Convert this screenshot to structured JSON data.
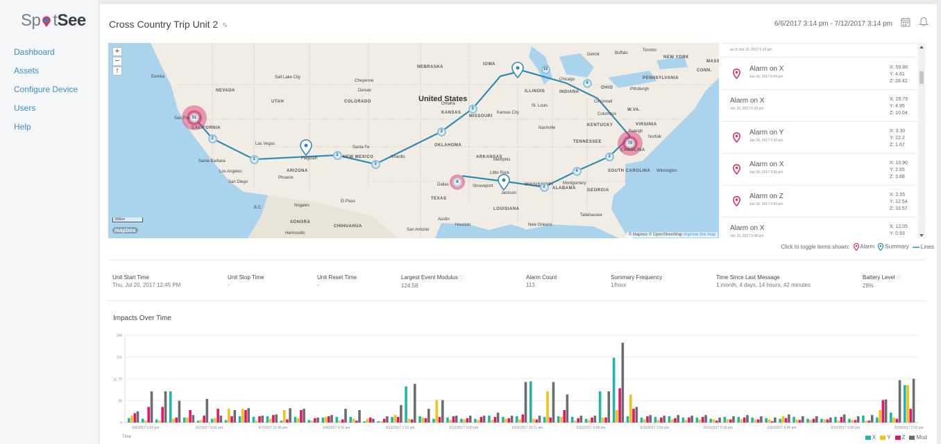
{
  "app": {
    "logo_left": "Sp",
    "logo_mid": "t",
    "logo_right": "See"
  },
  "sidebar": {
    "items": [
      {
        "label": "Dashboard"
      },
      {
        "label": "Assets"
      },
      {
        "label": "Configure Device"
      },
      {
        "label": "Users"
      },
      {
        "label": "Help"
      }
    ]
  },
  "header": {
    "title": "Cross Country Trip Unit 2",
    "date_range": "6/6/2017 3:14 pm  -  7/12/2017 3:14 pm",
    "edit_icon": "pencil-icon",
    "calendar_icon": "calendar-icon",
    "bell_icon": "bell-icon"
  },
  "map": {
    "zoom_in": "+",
    "zoom_out": "−",
    "compass": "↑",
    "scale": "300km",
    "provider": "mapbox",
    "attribution_prefix": "© Mapbox © OpenStreetMap ",
    "attribution_link": "Improve this map",
    "country_label": "United States",
    "state_labels": [
      "NEVADA",
      "UTAH",
      "COLORADO",
      "KANSAS",
      "MISSOURI",
      "NEBRASKA",
      "IOWA",
      "ILLINOIS",
      "INDIANA",
      "OHIO",
      "PENNSYLVANIA",
      "KENTUCKY",
      "TENNESSEE",
      "VIRGINIA",
      "W.VA.",
      "OKLAHOMA",
      "ARKANSAS",
      "TEXAS",
      "LOUISIANA",
      "MISSISSIPPI",
      "ALABAMA",
      "GEORGIA",
      "ARIZONA",
      "NEW MEXICO",
      "SONORA",
      "CHIHUAHUA",
      "CALIFORNIA",
      "SOUTH CAROLINA",
      "CAROLINA",
      "NEW YORK",
      "MASS.",
      "CONN."
    ],
    "city_labels": [
      "Eureka",
      "Salt Lake City",
      "Cheyenne",
      "Omaha",
      "Denver",
      "Detroit",
      "Buffalo",
      "Toronto",
      "Chicago",
      "Pittsburgh",
      "Cincinnati",
      "St. Louis",
      "Kansas City",
      "Las Vegas",
      "Flagstaff",
      "Santa Fe",
      "Amarillo",
      "Memphis",
      "Nashville",
      "Norfolk",
      "Wilmington",
      "Santa Barbara",
      "Los Angeles",
      "San Diego",
      "Phoenix",
      "El Paso",
      "Nogales",
      "Dallas",
      "Shreveport",
      "Jackson",
      "Austin",
      "Houston",
      "San Antonio",
      "New Orleans",
      "Tallahassee",
      "Hermosillo",
      "B.C.",
      "Columbus",
      "Raleigh",
      "San Francisco",
      "Montgomery",
      "Little Rock"
    ],
    "clusters": [
      {
        "count": "51",
        "kind": "alarm"
      },
      {
        "count": "2",
        "kind": "summary"
      },
      {
        "count": "3",
        "kind": "summary"
      },
      {
        "count": "2",
        "kind": "summary"
      },
      {
        "count": "3",
        "kind": "summary"
      },
      {
        "count": "3",
        "kind": "summary"
      },
      {
        "count": "3",
        "kind": "summary"
      },
      {
        "count": "15",
        "kind": "summary"
      },
      {
        "count": "4",
        "kind": "summary"
      },
      {
        "count": "70",
        "kind": "alarm"
      },
      {
        "count": "3",
        "kind": "summary"
      },
      {
        "count": "4",
        "kind": "summary"
      },
      {
        "count": "2",
        "kind": "summary"
      },
      {
        "count": "6",
        "kind": "alarm"
      }
    ]
  },
  "events": {
    "top_partial": "as of Jun 16, 2017 6:20 pm",
    "items": [
      {
        "title": "Alarm on X",
        "date": "Jun 16, 2017 6:04 pm",
        "x": "X:  59.88",
        "y": "Y:  4.61",
        "z": "Z:  28.42",
        "pin": true
      },
      {
        "title": "Alarm on X",
        "date": "Jun 16, 2017 6:03 pm",
        "x": "X:  29.79",
        "y": "Y:  4.95",
        "z": "Z:  10.04",
        "pin": false
      },
      {
        "title": "Alarm on Y",
        "date": "Jun 16, 2017 5:52 pm",
        "x": "X:  3.30",
        "y": "Y:  22.2",
        "z": "Z:  1.67",
        "pin": true
      },
      {
        "title": "Alarm on X",
        "date": "Jun 16, 2017 5:50 pm",
        "x": "X:  10.90",
        "y": "Y:  2.65",
        "z": "Z:  3.68",
        "pin": true
      },
      {
        "title": "Alarm on Z",
        "date": "Jun 16, 2017 5:50 pm",
        "x": "X:  2.55",
        "y": "Y:  12.54",
        "z": "Z:  33.57",
        "pin": true
      },
      {
        "title": "Alarm on X",
        "date": "Jun 16, 2017 5:48 pm",
        "x": "X:  12.05",
        "y": "Y:  0.93",
        "z": "Z:  3.77",
        "pin": false
      }
    ]
  },
  "toggle_legend": {
    "prefix": "Click to toggle items shown:",
    "alarm": "Alarm",
    "summary": "Summary",
    "lines": "Lines"
  },
  "stats": [
    {
      "label": "Unit Start Time",
      "value": "Thu, Jul 20, 2017 12:45 PM",
      "info": false
    },
    {
      "label": "Unit Stop Time",
      "value": "-",
      "info": false
    },
    {
      "label": "Unit Reset Time",
      "value": "-",
      "info": false
    },
    {
      "label": "Largest Event Modulus",
      "value": "124.58",
      "info": true
    },
    {
      "label": "Alarm Count",
      "value": "113",
      "info": false
    },
    {
      "label": "Summary Frequency",
      "value": "1/hour",
      "info": false
    },
    {
      "label": "Time Since Last Message",
      "value": "1 month, 4 days, 14 hours, 42 minutes",
      "info": false
    },
    {
      "label": "Battery Level",
      "value": "28%",
      "info": true
    }
  ],
  "colors": {
    "accent": "#3e8fc6",
    "alarm": "#d6336c",
    "summary": "#2e8bb5",
    "x": "#1fb5ad",
    "y": "#f5c211",
    "z": "#e5146f",
    "mod": "#6d6d6d"
  },
  "chart_data": {
    "type": "bar",
    "title": "Impacts Over Time",
    "xlabel": "Time",
    "ylabel": "G",
    "ylim": [
      0,
      140
    ],
    "yticks": [
      0,
      35,
      70,
      105,
      140
    ],
    "grid": true,
    "legend": "bottom-right",
    "x_tick_labels": [
      "6/6/2017 5:53 pm",
      "6/7/2017 5:01 pm",
      "6/7/2017 11:46 pm",
      "6/8/2017 4:16 am",
      "6/13/2017 1:22 pm",
      "6/13/2017 2:00 pm",
      "6/14/2017 10:11 am",
      "6/15/2017 5:58 pm",
      "6/16/2017 2:54 pm",
      "6/16/2017 5:39 pm",
      "6/16/2017 5:45 pm",
      "6/16/2017 5:50 pm",
      "6/20/2017 2:02 pm"
    ],
    "series": [
      {
        "name": "X",
        "values": [
          7,
          6,
          5,
          50,
          8,
          3,
          6,
          4,
          10,
          9,
          10,
          3,
          9,
          4,
          8,
          9,
          9,
          2,
          2,
          9,
          58,
          10,
          6,
          8,
          6,
          6,
          11,
          9,
          10,
          66,
          9,
          10,
          9,
          6,
          50,
          104,
          10,
          8,
          9,
          10,
          8,
          8,
          6,
          9,
          9,
          8,
          7,
          6,
          9,
          6,
          6,
          9,
          6,
          11,
          8,
          16,
          60
        ]
      },
      {
        "name": "Y",
        "values": [
          11,
          3,
          3,
          6,
          8,
          4,
          7,
          22,
          22,
          3,
          6,
          20,
          7,
          3,
          9,
          3,
          6,
          6,
          2,
          12,
          6,
          8,
          36,
          4,
          5,
          4,
          4,
          6,
          5,
          6,
          50,
          9,
          3,
          4,
          8,
          20,
          45,
          5,
          4,
          5,
          4,
          5,
          5,
          5,
          5,
          5,
          5,
          10,
          5,
          4,
          5,
          3,
          4,
          3,
          20,
          8,
          60
        ]
      },
      {
        "name": "Z",
        "values": [
          15,
          25,
          25,
          8,
          20,
          11,
          22,
          10,
          20,
          10,
          12,
          5,
          20,
          7,
          10,
          5,
          3,
          8,
          6,
          9,
          5,
          7,
          9,
          10,
          7,
          9,
          9,
          7,
          13,
          5,
          8,
          20,
          7,
          8,
          8,
          55,
          22,
          10,
          8,
          7,
          8,
          9,
          3,
          5,
          8,
          5,
          2,
          7,
          4,
          6,
          5,
          9,
          4,
          3,
          36,
          6,
          22
        ]
      },
      {
        "name": "Mod",
        "values": [
          18,
          50,
          50,
          35,
          12,
          38,
          11,
          20,
          23,
          11,
          13,
          23,
          22,
          8,
          12,
          22,
          20,
          6,
          10,
          28,
          62,
          22,
          36,
          11,
          11,
          11,
          16,
          11,
          65,
          11,
          65,
          45,
          11,
          11,
          50,
          128,
          25,
          12,
          11,
          12,
          11,
          12,
          8,
          10,
          12,
          10,
          8,
          13,
          10,
          10,
          8,
          13,
          10,
          12,
          37,
          68,
          70
        ]
      }
    ]
  }
}
